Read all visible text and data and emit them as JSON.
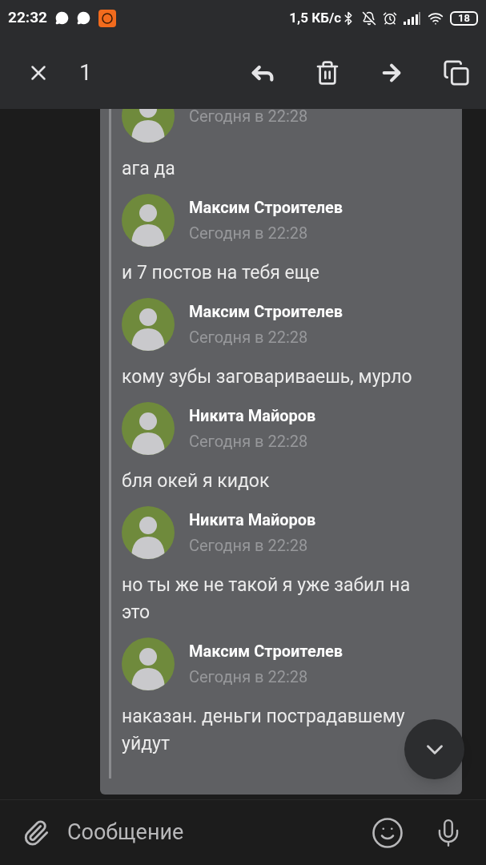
{
  "status_bar": {
    "time": "22:32",
    "speed": "1,5 КБ/с",
    "battery": "18"
  },
  "selection_bar": {
    "count": "1"
  },
  "messages": [
    {
      "time": "Сегодня в 22:28",
      "text": "ага да"
    },
    {
      "name": "Максим Строителев",
      "time": "Сегодня в 22:28",
      "text": "и 7 постов на тебя еще"
    },
    {
      "name": "Максим Строителев",
      "time": "Сегодня в 22:28",
      "text": "кому зубы заговариваешь, мурло"
    },
    {
      "name": "Никита Майоров",
      "time": "Сегодня в 22:28",
      "text": "бля окей я кидок"
    },
    {
      "name": "Никита Майоров",
      "time": "Сегодня в 22:28",
      "text": "но ты же не такой я уже забил на это"
    },
    {
      "name": "Максим Строителев",
      "time": "Сегодня в 22:28",
      "text": "наказан. деньги пострадавшему уйдут"
    }
  ],
  "composer": {
    "placeholder": "Сообщение"
  }
}
